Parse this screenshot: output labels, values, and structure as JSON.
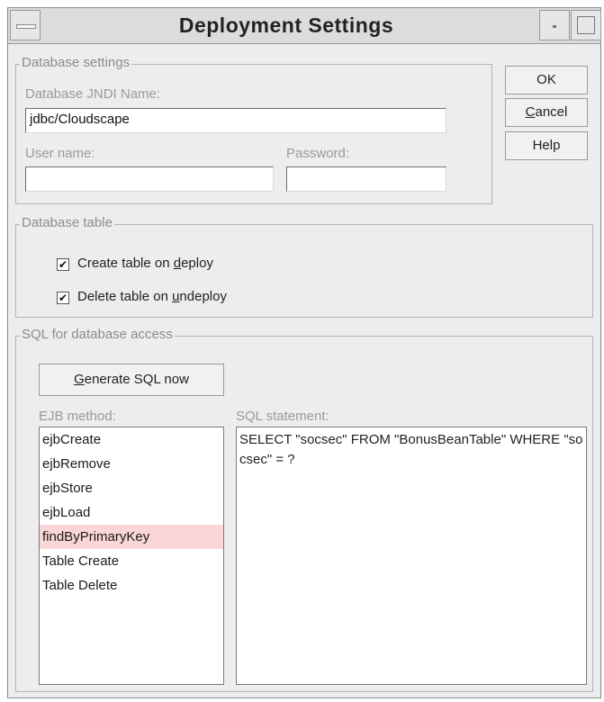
{
  "window": {
    "title": "Deployment Settings"
  },
  "buttons": {
    "ok": "OK",
    "cancel": "Cancel",
    "help": "Help",
    "generate_sql": "Generate SQL now"
  },
  "database_settings": {
    "legend": "Database settings",
    "jndi_label": "Database JNDI Name:",
    "jndi_value": "jdbc/Cloudscape",
    "user_label": "User name:",
    "user_value": "",
    "password_label": "Password:",
    "password_value": ""
  },
  "database_table": {
    "legend": "Database table",
    "create": {
      "prefix": "Create table on ",
      "mnemonic": "d",
      "suffix": "eploy",
      "checked": true
    },
    "delete": {
      "prefix": "Delete table on ",
      "mnemonic": "u",
      "suffix": "ndeploy",
      "checked": true
    }
  },
  "sql_access": {
    "legend": "SQL for database access",
    "ejb_method_label": "EJB method:",
    "sql_statement_label": "SQL statement:",
    "methods": [
      "ejbCreate",
      "ejbRemove",
      "ejbStore",
      "ejbLoad",
      "findByPrimaryKey",
      "Table Create",
      "Table Delete"
    ],
    "selected_method": "findByPrimaryKey",
    "sql_statement": "SELECT \"socsec\" FROM \"BonusBeanTable\" WHERE \"socsec\" = ?"
  },
  "colors": {
    "selection": "#fbd6d6",
    "dialog_bg": "#ededed"
  }
}
